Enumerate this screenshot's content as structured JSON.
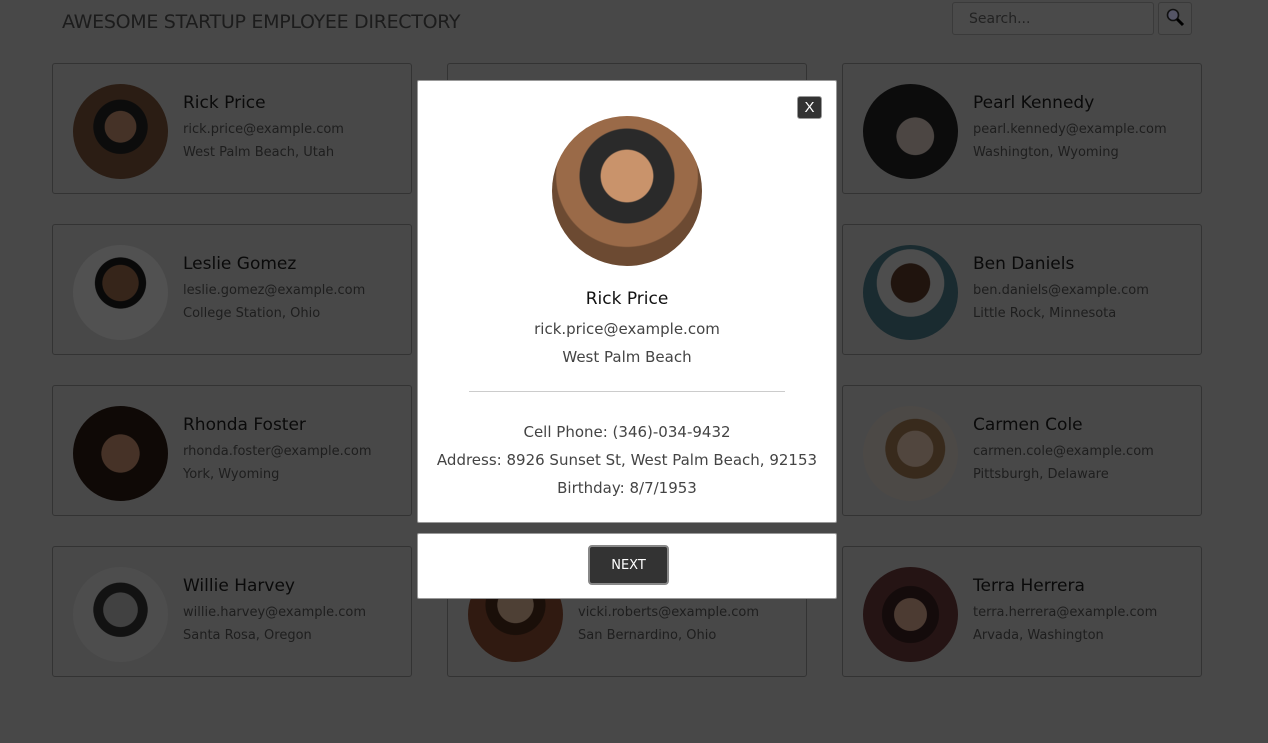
{
  "header": {
    "title": "AWESOME STARTUP EMPLOYEE DIRECTORY",
    "search_placeholder": "Search...",
    "search_icon": "magnifier-icon"
  },
  "employees": [
    {
      "name": "Rick Price",
      "email": "rick.price@example.com",
      "location": "West Palm Beach, Utah"
    },
    {
      "name": "Pearl Kennedy",
      "email": "pearl.kennedy@example.com",
      "location": "Washington, Wyoming"
    },
    {
      "name": "Leslie Gomez",
      "email": "leslie.gomez@example.com",
      "location": "College Station, Ohio"
    },
    {
      "name": "Ben Daniels",
      "email": "ben.daniels@example.com",
      "location": "Little Rock, Minnesota"
    },
    {
      "name": "Rhonda Foster",
      "email": "rhonda.foster@example.com",
      "location": "York, Wyoming"
    },
    {
      "name": "Carmen Cole",
      "email": "carmen.cole@example.com",
      "location": "Pittsburgh, Delaware"
    },
    {
      "name": "Willie Harvey",
      "email": "willie.harvey@example.com",
      "location": "Santa Rosa, Oregon"
    },
    {
      "email": "vicki.roberts@example.com",
      "location": "San Bernardino, Ohio"
    },
    {
      "name": "Terra Herrera",
      "email": "terra.herrera@example.com",
      "location": "Arvada, Washington"
    }
  ],
  "modal": {
    "close_label": "X",
    "name": "Rick Price",
    "email": "rick.price@example.com",
    "city": "West Palm Beach",
    "phone": "Cell Phone: (346)-034-9432",
    "address": "Address: 8926 Sunset St, West Palm Beach, 92153",
    "birthday": "Birthday: 8/7/1953",
    "next_label": "NEXT"
  }
}
